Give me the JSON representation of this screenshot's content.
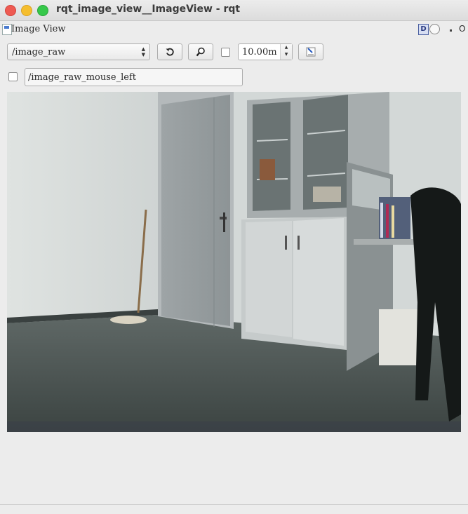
{
  "window": {
    "title": "rqt_image_view__ImageView - rqt"
  },
  "plugin": {
    "title": "Image View",
    "header_d_label": "D",
    "header_close_label": "O"
  },
  "toolbar": {
    "topic": "/image_raw",
    "timeout_value": "10.00m",
    "mouse_topic": "/image_raw_mouse_left"
  },
  "icons": {
    "refresh": "refresh-icon",
    "zoom": "magnifier-icon",
    "save": "save-image-icon"
  },
  "colors": {
    "window_bg": "#ececec",
    "close": "#ee5a52",
    "minimize": "#f5be2e",
    "maximize": "#36c84a"
  }
}
